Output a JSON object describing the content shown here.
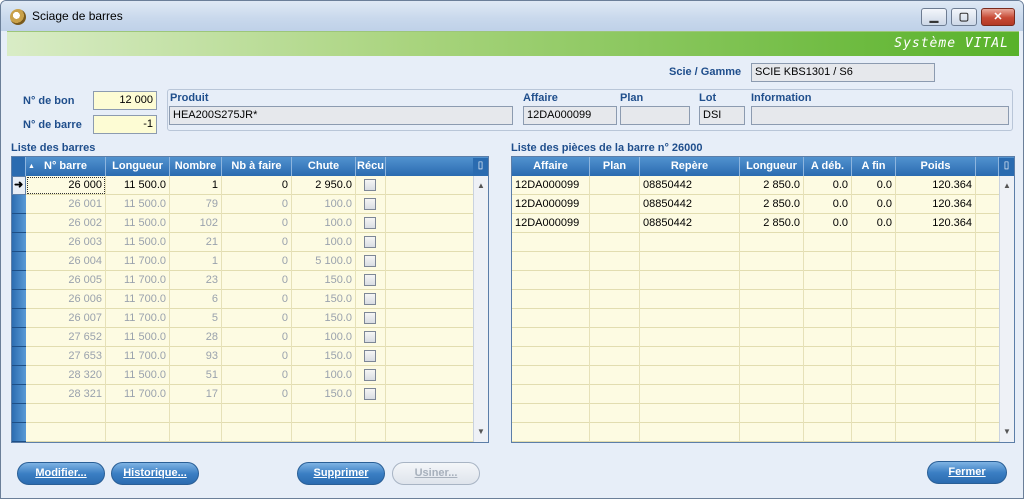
{
  "window": {
    "title": "Sciage de barres",
    "brand": "Système VITAL",
    "controls": {
      "minimize": "▁",
      "maximize": "▢",
      "close": "✕"
    }
  },
  "header": {
    "scie_label": "Scie / Gamme",
    "scie_value": "SCIE KBS1301 / S6",
    "bon_label": "N° de bon",
    "bon_value": "12 000",
    "barre_label": "N° de barre",
    "barre_value": "-1",
    "produit_label": "Produit",
    "produit_value": "HEA200S275JR*",
    "affaire_label": "Affaire",
    "affaire_value": "12DA000099",
    "plan_label": "Plan",
    "plan_value": "",
    "lot_label": "Lot",
    "lot_value": "DSI",
    "info_label": "Information",
    "info_value": ""
  },
  "bars": {
    "title": "Liste des barres",
    "columns": [
      "N° barre",
      "Longueur",
      "Nombre",
      "Nb à faire",
      "Chute",
      "Récu"
    ],
    "rows": [
      {
        "num": "26 000",
        "len": "11 500.0",
        "nb": "1",
        "todo": "0",
        "chute": "2 950.0"
      },
      {
        "num": "26 001",
        "len": "11 500.0",
        "nb": "79",
        "todo": "0",
        "chute": "100.0"
      },
      {
        "num": "26 002",
        "len": "11 500.0",
        "nb": "102",
        "todo": "0",
        "chute": "100.0"
      },
      {
        "num": "26 003",
        "len": "11 500.0",
        "nb": "21",
        "todo": "0",
        "chute": "100.0"
      },
      {
        "num": "26 004",
        "len": "11 700.0",
        "nb": "1",
        "todo": "0",
        "chute": "5 100.0"
      },
      {
        "num": "26 005",
        "len": "11 700.0",
        "nb": "23",
        "todo": "0",
        "chute": "150.0"
      },
      {
        "num": "26 006",
        "len": "11 700.0",
        "nb": "6",
        "todo": "0",
        "chute": "150.0"
      },
      {
        "num": "26 007",
        "len": "11 700.0",
        "nb": "5",
        "todo": "0",
        "chute": "150.0"
      },
      {
        "num": "27 652",
        "len": "11 500.0",
        "nb": "28",
        "todo": "0",
        "chute": "100.0"
      },
      {
        "num": "27 653",
        "len": "11 700.0",
        "nb": "93",
        "todo": "0",
        "chute": "150.0"
      },
      {
        "num": "28 320",
        "len": "11 500.0",
        "nb": "51",
        "todo": "0",
        "chute": "100.0"
      },
      {
        "num": "28 321",
        "len": "11 700.0",
        "nb": "17",
        "todo": "0",
        "chute": "150.0"
      }
    ]
  },
  "pieces": {
    "title": "Liste des pièces de la barre n° 26000",
    "columns": [
      "Affaire",
      "Plan",
      "Repère",
      "Longueur",
      "A déb.",
      "A fin",
      "Poids"
    ],
    "rows": [
      {
        "affaire": "12DA000099",
        "plan": "",
        "repere": "08850442",
        "len": "2 850.0",
        "adeb": "0.0",
        "afin": "0.0",
        "poids": "120.364"
      },
      {
        "affaire": "12DA000099",
        "plan": "",
        "repere": "08850442",
        "len": "2 850.0",
        "adeb": "0.0",
        "afin": "0.0",
        "poids": "120.364"
      },
      {
        "affaire": "12DA000099",
        "plan": "",
        "repere": "08850442",
        "len": "2 850.0",
        "adeb": "0.0",
        "afin": "0.0",
        "poids": "120.364"
      }
    ]
  },
  "buttons": {
    "modifier": "Modifier...",
    "historique": "Historique...",
    "supprimer": "Supprimer",
    "usiner": "Usiner...",
    "fermer": "Fermer"
  },
  "icons": {
    "app": "saw-app-icon",
    "grid_settings": "grid-settings-icon",
    "sort": "sort-icon",
    "current_row": "current-row-arrow-icon"
  }
}
